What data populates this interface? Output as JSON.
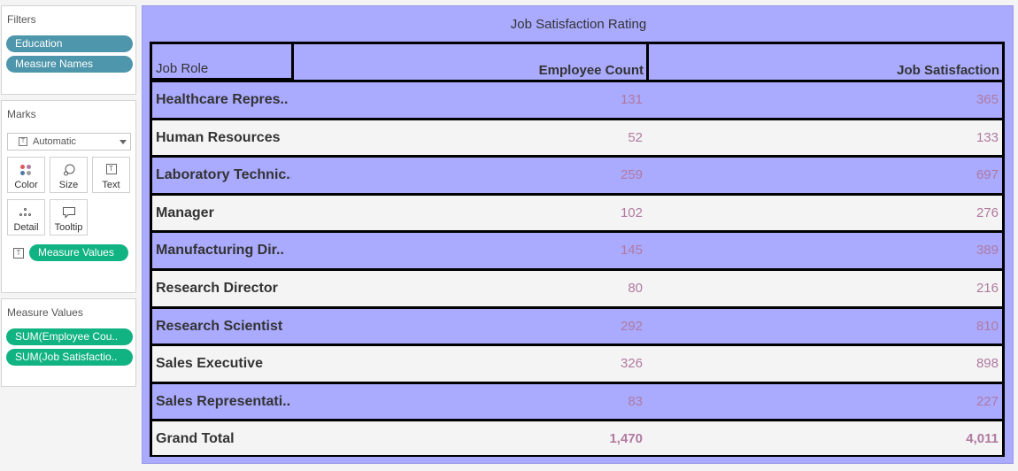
{
  "filters": {
    "title": "Filters",
    "pills": [
      "Education",
      "Measure Names"
    ]
  },
  "marks": {
    "title": "Marks",
    "mark_type": "Automatic",
    "buttons": [
      "Color",
      "Size",
      "Text",
      "Detail",
      "Tooltip"
    ],
    "text_pill": "Measure Values"
  },
  "measure_values": {
    "title": "Measure Values",
    "pills": [
      "SUM(Employee Cou..",
      "SUM(Job Satisfactio.."
    ]
  },
  "sheet": {
    "title": "Job Satisfaction Rating",
    "columns": [
      "Job Role",
      "Employee Count",
      "Job Satisfaction"
    ],
    "rows": [
      {
        "role": "Healthcare Repres..",
        "employee_count": "131",
        "job_satisfaction": "365"
      },
      {
        "role": "Human Resources",
        "employee_count": "52",
        "job_satisfaction": "133"
      },
      {
        "role": "Laboratory Technic..",
        "employee_count": "259",
        "job_satisfaction": "697"
      },
      {
        "role": "Manager",
        "employee_count": "102",
        "job_satisfaction": "276"
      },
      {
        "role": "Manufacturing Dir..",
        "employee_count": "145",
        "job_satisfaction": "389"
      },
      {
        "role": "Research Director",
        "employee_count": "80",
        "job_satisfaction": "216"
      },
      {
        "role": "Research Scientist",
        "employee_count": "292",
        "job_satisfaction": "810"
      },
      {
        "role": "Sales Executive",
        "employee_count": "326",
        "job_satisfaction": "898"
      },
      {
        "role": "Sales Representati..",
        "employee_count": "83",
        "job_satisfaction": "227"
      }
    ],
    "total": {
      "role": "Grand Total",
      "employee_count": "1,470",
      "job_satisfaction": "4,011"
    }
  },
  "colors": {
    "band": "#aaaaff",
    "plain": "#f4f4f4",
    "value_text": "#b07aa1",
    "filter_pill": "#4e96ab",
    "measure_pill": "#11b383"
  }
}
